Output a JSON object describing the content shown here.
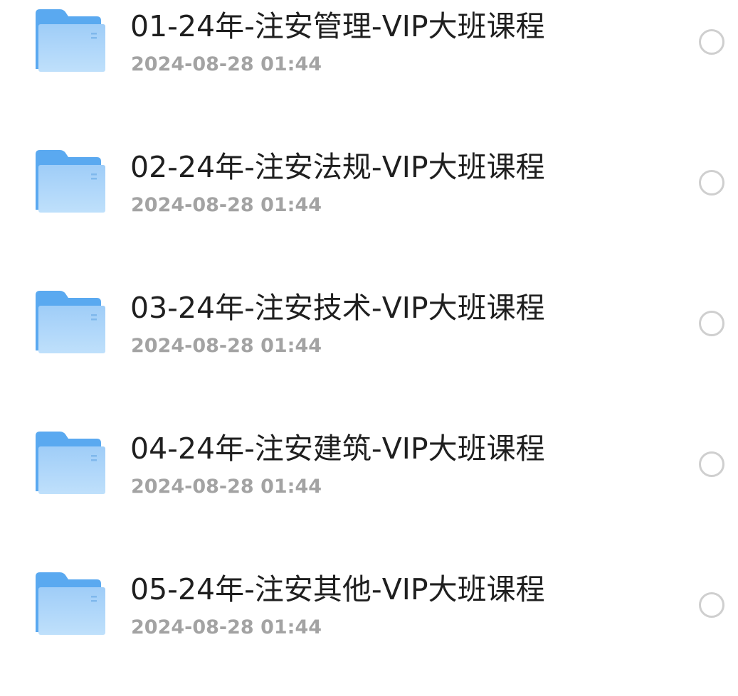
{
  "files": [
    {
      "name": "01-24年-注安管理-VIP大班课程",
      "modified": "2024-08-28 01:44",
      "selected": false
    },
    {
      "name": "02-24年-注安法规-VIP大班课程",
      "modified": "2024-08-28 01:44",
      "selected": false
    },
    {
      "name": "03-24年-注安技术-VIP大班课程",
      "modified": "2024-08-28 01:44",
      "selected": false
    },
    {
      "name": "04-24年-注安建筑-VIP大班课程",
      "modified": "2024-08-28 01:44",
      "selected": false
    },
    {
      "name": "05-24年-注安其他-VIP大班课程",
      "modified": "2024-08-28 01:44",
      "selected": false
    }
  ],
  "icons": {
    "folder": "folder-icon",
    "select": "radio-unchecked-icon"
  },
  "colors": {
    "folder_back": "#5aa9f0",
    "folder_front": "#a9d3f9",
    "title_text": "#1f1f1f",
    "time_text": "#a3a3a3",
    "radio_border": "#cfcfcf"
  }
}
